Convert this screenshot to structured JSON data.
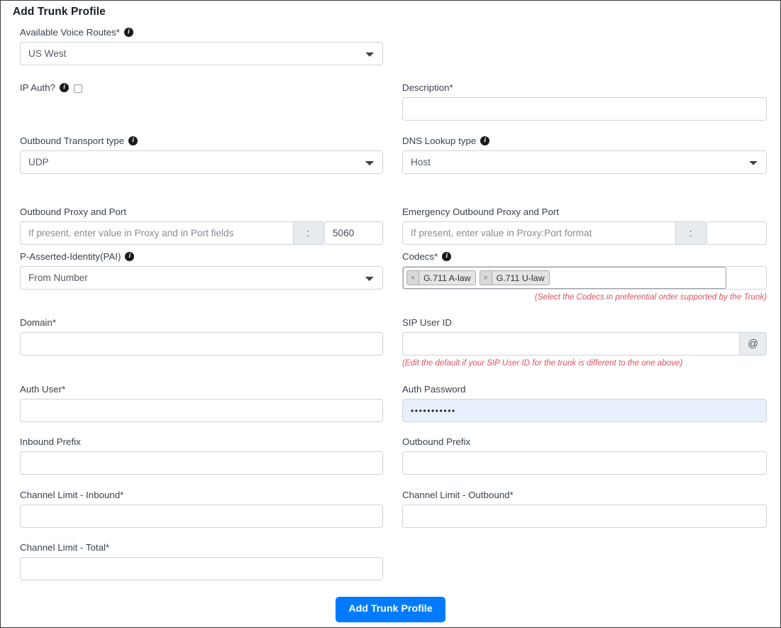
{
  "page": {
    "title": "Add Trunk Profile"
  },
  "fields": {
    "available_voice_routes": {
      "label": "Available Voice Routes*",
      "info": "info-icon",
      "value": "US West",
      "options": [
        "US West"
      ]
    },
    "ip_auth": {
      "label": "IP Auth?",
      "info": "info-icon",
      "checked": false
    },
    "description": {
      "label": "Description*",
      "value": "",
      "placeholder": ""
    },
    "outbound_transport_type": {
      "label": "Outbound Transport type",
      "info": "info-icon",
      "value": "UDP",
      "options": [
        "UDP"
      ]
    },
    "dns_lookup_type": {
      "label": "DNS Lookup type",
      "info": "info-icon",
      "value": "Host",
      "options": [
        "Host"
      ]
    },
    "outbound_proxy": {
      "label": "Outbound Proxy and Port",
      "placeholder": "If present, enter value in Proxy and in Port fields",
      "value": "",
      "separator": ":",
      "port_value": "5060"
    },
    "emergency_outbound_proxy": {
      "label": "Emergency Outbound Proxy and Port",
      "placeholder": "If present, enter value in Proxy:Port format",
      "value": "",
      "separator": ":",
      "port_value": ""
    },
    "pai": {
      "label": "P-Asserted-Identity(PAI)",
      "info": "info-icon",
      "value": "From Number",
      "options": [
        "From Number"
      ]
    },
    "codecs": {
      "label": "Codecs*",
      "info": "info-icon",
      "tags": [
        {
          "remove": "×",
          "label": "G.711 A-law"
        },
        {
          "remove": "×",
          "label": "G.711 U-law"
        }
      ],
      "helper": "(Select the Codecs in preferential order supported by the Trunk)"
    },
    "domain": {
      "label": "Domain*",
      "value": ""
    },
    "sip_user_id": {
      "label": "SIP User ID",
      "value": "",
      "addon": "@",
      "helper": "(Edit the default if your SIP User ID for the trunk is different to the one above)"
    },
    "auth_user": {
      "label": "Auth User*",
      "value": ""
    },
    "auth_password": {
      "label": "Auth Password",
      "value": "•••••••••••"
    },
    "inbound_prefix": {
      "label": "Inbound Prefix",
      "value": ""
    },
    "outbound_prefix": {
      "label": "Outbound Prefix",
      "value": ""
    },
    "channel_limit_inbound": {
      "label": "Channel Limit - Inbound*",
      "value": ""
    },
    "channel_limit_outbound": {
      "label": "Channel Limit - Outbound*",
      "value": ""
    },
    "channel_limit_total": {
      "label": "Channel Limit - Total*",
      "value": ""
    }
  },
  "submit": {
    "label": "Add Trunk Profile"
  },
  "colors": {
    "primary": "#007bff",
    "helper_red": "#e05260",
    "autofill_blue": "#e8f0fe",
    "addon_grey": "#e9ecef",
    "border_grey": "#ced4da"
  }
}
